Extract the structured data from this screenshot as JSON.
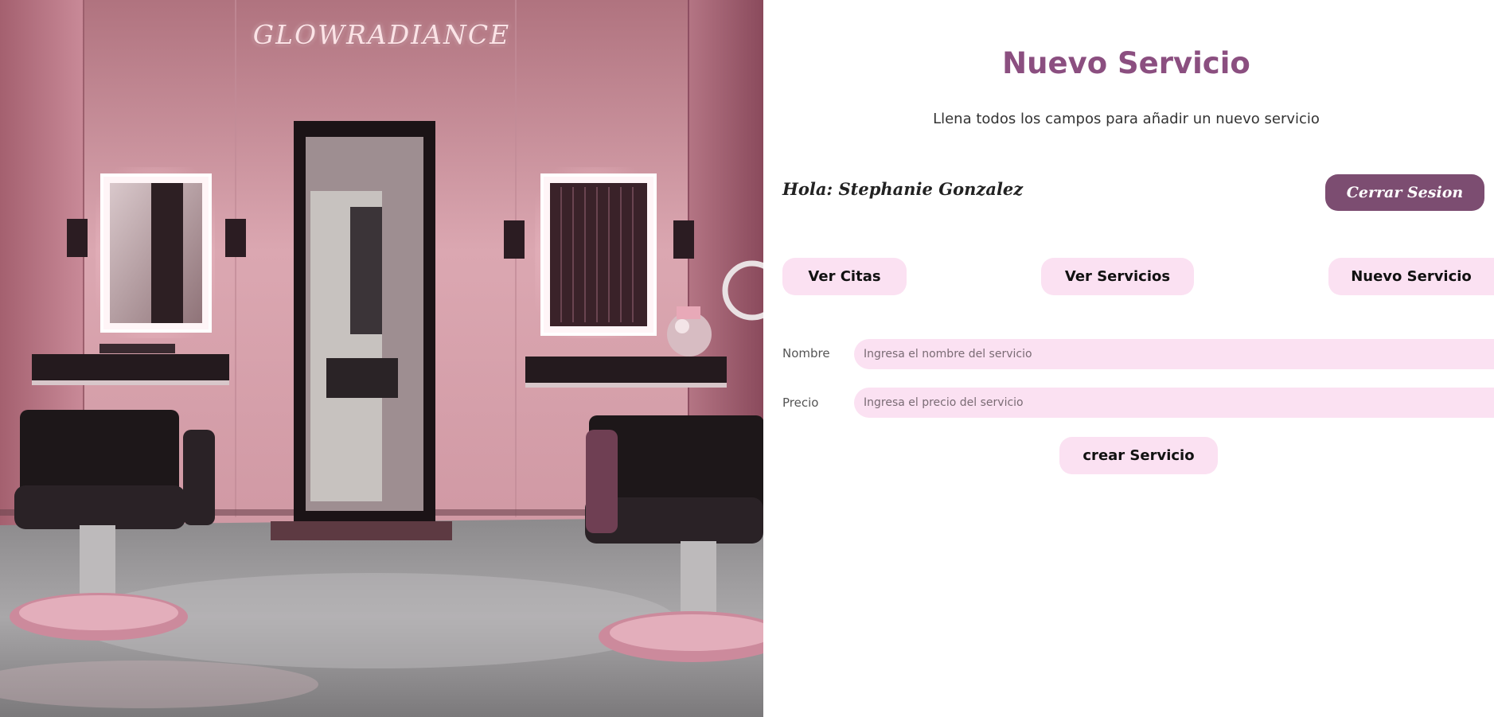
{
  "brand": {
    "name": "GLOWRADIANCE"
  },
  "hero": {
    "image": "salon-interior-image"
  },
  "page": {
    "title": "Nuevo Servicio",
    "subtitle": "Llena todos los campos para añadir un nuevo servicio"
  },
  "user": {
    "greeting": "Hola: Stephanie Gonzalez",
    "logout_label": "Cerrar Sesion"
  },
  "nav": {
    "ver_citas": "Ver Citas",
    "ver_servicios": "Ver Servicios",
    "nuevo_servicio": "Nuevo Servicio"
  },
  "form": {
    "nombre_label": "Nombre",
    "nombre_placeholder": "Ingresa el nombre del servicio",
    "nombre_value": "",
    "precio_label": "Precio",
    "precio_placeholder": "Ingresa el precio del servicio",
    "precio_value": "",
    "submit_label": "crear Servicio"
  },
  "colors": {
    "accent": "#8b4f80",
    "logout_button": "#7c4d71",
    "pill_background": "#fbe1f2",
    "hero_wall": "#d79aa6"
  }
}
